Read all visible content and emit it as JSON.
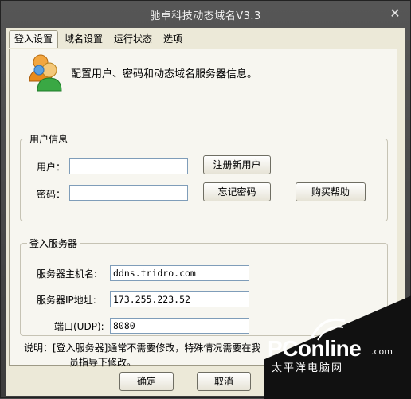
{
  "window": {
    "title": "驰卓科技动态域名V3.3",
    "close_glyph": "✕"
  },
  "tabs": [
    {
      "label": "登入设置",
      "active": true
    },
    {
      "label": "域名设置",
      "active": false
    },
    {
      "label": "运行状态",
      "active": false
    },
    {
      "label": "选项",
      "active": false
    }
  ],
  "header": {
    "text": "配置用户、密码和动态域名服务器信息。",
    "icon": "users-icon"
  },
  "user_group": {
    "label": "用户信息",
    "user_label": "用户：",
    "user_value": "",
    "password_label": "密码：",
    "password_value": "",
    "register_btn": "注册新用户",
    "forgot_btn": "忘记密码",
    "buy_help_btn": "购买帮助"
  },
  "server_group": {
    "label": "登入服务器",
    "host_label": "服务器主机名:",
    "host_value": "ddns.tridro.com",
    "ip_label": "服务器IP地址:",
    "ip_value": "173.255.223.52",
    "port_label": "端口(UDP):",
    "port_value": "8080"
  },
  "note": {
    "line1": "说明：[登入服务器]通常不需要修改，特殊情况需要在我",
    "line2": "员指导下修改。"
  },
  "buttons": {
    "ok": "确定",
    "cancel": "取消"
  },
  "watermark": {
    "logo": "PConline",
    "domain": ".com",
    "sub": "太平洋电脑网"
  },
  "colors": {
    "client_bg": "#ece9d8",
    "panel_bg": "#f7f6f0",
    "titlebar": "#4a4a4a"
  }
}
